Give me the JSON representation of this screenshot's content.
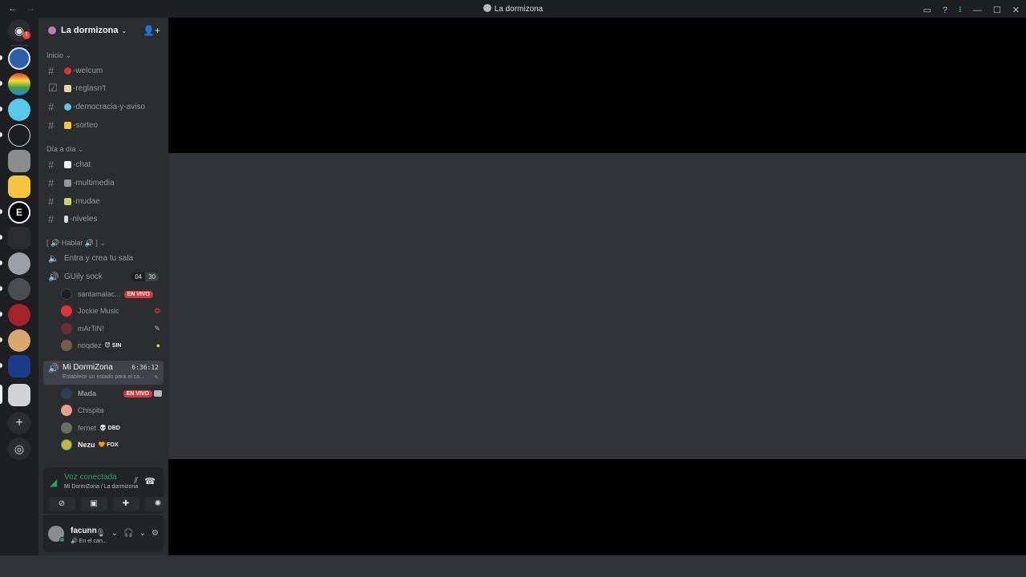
{
  "titlebar": {
    "back": "←",
    "forward": "→",
    "title": "La dormizona",
    "inbox": "▭",
    "help": "?",
    "download": "⭳",
    "minimize": "—",
    "maximize": "☐",
    "close": "✕"
  },
  "rail": {
    "home_badge": "1",
    "home_icon": "◉",
    "add_server": "+",
    "discover": "◎"
  },
  "server": {
    "name": "La dormizona",
    "chevron": "⌄",
    "invite_icon": "👤+"
  },
  "categories": {
    "inicio": "Inicio ⌄",
    "dia": "Día a día ⌄",
    "hablar": "[ 🔊 Hablar 🔊 ] ⌄"
  },
  "channels": {
    "welcum": "-welcum",
    "reglas": "-reglasn't",
    "democracia": "-democracia-y-aviso",
    "sorteo": "-sorteo",
    "chat": "-chat",
    "multimedia": "-multimedia",
    "mudae": "-mudae",
    "niveles": "-niveles",
    "entra": "Entra y crea tu sala",
    "guily": "GUily sock",
    "guily_count_a": "04",
    "guily_count_b": "30"
  },
  "voice_users_guily": [
    {
      "name": "santamalac...",
      "badge": "EN VIVO",
      "color": "#1e1f22"
    },
    {
      "name": "Jockie Music",
      "badge": "",
      "color": "#da373c"
    },
    {
      "name": "mArTiN!",
      "badge": "",
      "color": "#6d2f35"
    },
    {
      "name": "noqdez",
      "tag": "😈 SIN",
      "color": "#7a5c4a"
    }
  ],
  "my_channel": {
    "name": "Mi DormiZona",
    "time": "6:36:12",
    "status": "Establece un estado para el ca..."
  },
  "voice_users_mine": [
    {
      "name": "Mada",
      "badge": "EN VIVO",
      "color": "#2b3f56"
    },
    {
      "name": "Chispita",
      "color": "#e8a08e"
    },
    {
      "name": "fernet",
      "tag": "💀 DBD",
      "color": "#6b6f60"
    },
    {
      "name": "Nezu",
      "tag": "🧡 FOX",
      "color": "#c9b24a"
    }
  ],
  "voice_panel": {
    "state": "Voz conectada",
    "location": "Mi DormiZona / La dormizona"
  },
  "user_panel": {
    "name": "facunn",
    "status": "🔊 En el can..."
  }
}
